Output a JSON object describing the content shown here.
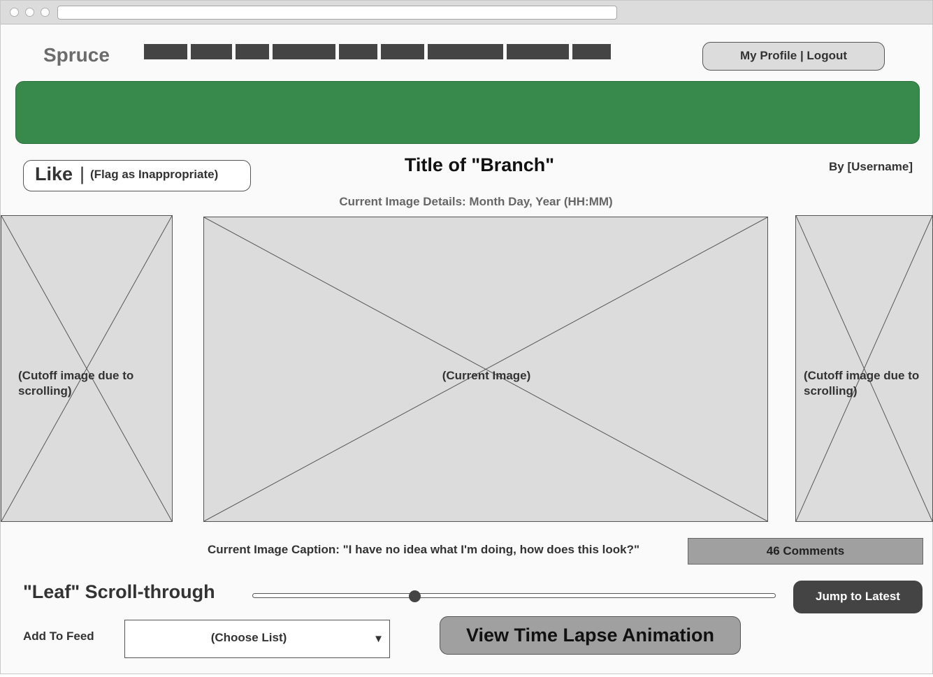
{
  "header": {
    "logo": "Spruce",
    "nav_items": [
      "",
      "",
      "",
      "",
      "",
      "",
      "",
      "",
      ""
    ],
    "profile_button": "My Profile | Logout"
  },
  "colors": {
    "banner": "#378a4c",
    "dark_button": "#444444",
    "gray_button": "#a0a0a0",
    "placeholder": "#dcdcdc"
  },
  "post": {
    "like_label": "Like",
    "like_separator": "|",
    "flag_label": "(Flag as Inappropriate)",
    "title": "Title of \"Branch\"",
    "author": "By [Username]",
    "image_details": "Current Image Details: Month Day, Year (HH:MM)"
  },
  "gallery": {
    "left_image": "(Cutoff image due to scrolling)",
    "current_image": "(Current Image)",
    "right_image": "(Cutoff image due to scrolling)"
  },
  "caption": "Current Image Caption: \"I have no idea what I'm doing, how does this look?\"",
  "comments_button": "46 Comments",
  "leaf": {
    "title": "\"Leaf\" Scroll-through",
    "slider_value": 0.31,
    "jump_button": "Jump to Latest"
  },
  "feed": {
    "label": "Add To Feed",
    "select_value": "(Choose List)"
  },
  "timelapse_button": "View Time Lapse Animation",
  "icons": {
    "dropdown": "chevron-down-icon"
  }
}
